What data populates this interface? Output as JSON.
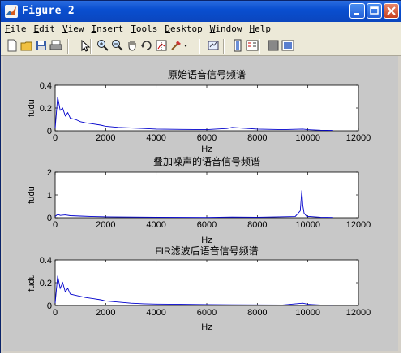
{
  "window": {
    "title": "Figure 2"
  },
  "menu": [
    {
      "label": "File",
      "u": "F",
      "rest": "ile"
    },
    {
      "label": "Edit",
      "u": "E",
      "rest": "dit"
    },
    {
      "label": "View",
      "u": "V",
      "rest": "iew"
    },
    {
      "label": "Insert",
      "u": "I",
      "rest": "nsert"
    },
    {
      "label": "Tools",
      "u": "T",
      "rest": "ools"
    },
    {
      "label": "Desktop",
      "u": "D",
      "rest": "esktop"
    },
    {
      "label": "Window",
      "u": "W",
      "rest": "indow"
    },
    {
      "label": "Help",
      "u": "H",
      "rest": "elp"
    }
  ],
  "toolbar": [
    {
      "icon": "new-figure-icon"
    },
    {
      "icon": "open-file-icon"
    },
    {
      "icon": "save-icon"
    },
    {
      "icon": "print-icon"
    },
    {
      "icon": "edit-plot-arrow-icon"
    },
    {
      "icon": "zoom-in-icon"
    },
    {
      "icon": "zoom-out-icon"
    },
    {
      "icon": "pan-hand-icon"
    },
    {
      "icon": "rotate-3d-icon"
    },
    {
      "icon": "data-cursor-icon"
    },
    {
      "icon": "brush-icon"
    },
    {
      "icon": "brush-dropdown-icon"
    },
    {
      "icon": "link-plot-icon"
    },
    {
      "icon": "insert-colorbar-icon"
    },
    {
      "icon": "insert-legend-icon"
    },
    {
      "icon": "hide-plot-tools-icon"
    },
    {
      "icon": "show-plot-tools-icon"
    }
  ],
  "chart_data": [
    {
      "type": "line",
      "title": "原始语音信号频谱",
      "xlabel": "Hz",
      "ylabel": "fudu",
      "xlim": [
        0,
        12000
      ],
      "ylim": [
        0,
        0.4
      ],
      "xticks": [
        "0",
        "2000",
        "4000",
        "6000",
        "8000",
        "10000",
        "12000"
      ],
      "yticks": [
        "0",
        "0.2",
        "0.4"
      ],
      "series": [
        {
          "color": "#0000cc",
          "x": [
            0,
            100,
            200,
            300,
            400,
            500,
            600,
            800,
            1000,
            1200,
            1500,
            1800,
            2000,
            2500,
            3000,
            3500,
            4000,
            5000,
            6000,
            6800,
            7000,
            7300,
            8000,
            9000,
            9800,
            10000,
            10500,
            11000
          ],
          "y": [
            0.02,
            0.3,
            0.18,
            0.2,
            0.13,
            0.16,
            0.11,
            0.1,
            0.08,
            0.07,
            0.06,
            0.05,
            0.04,
            0.03,
            0.025,
            0.02,
            0.015,
            0.012,
            0.01,
            0.02,
            0.03,
            0.025,
            0.015,
            0.01,
            0.015,
            0.01,
            0.005,
            0.003
          ]
        }
      ]
    },
    {
      "type": "line",
      "title": "叠加噪声的语音信号频谱",
      "xlabel": "Hz",
      "ylabel": "fudu",
      "xlim": [
        0,
        12000
      ],
      "ylim": [
        0,
        2
      ],
      "xticks": [
        "0",
        "2000",
        "4000",
        "6000",
        "8000",
        "10000",
        "12000"
      ],
      "yticks": [
        "0",
        "1",
        "2"
      ],
      "series": [
        {
          "color": "#0000cc",
          "x": [
            0,
            100,
            200,
            400,
            600,
            1000,
            1500,
            2000,
            3000,
            4000,
            6000,
            7000,
            8000,
            9500,
            9700,
            9760,
            9800,
            9850,
            9950,
            10500,
            11000
          ],
          "y": [
            0.05,
            0.15,
            0.1,
            0.12,
            0.09,
            0.07,
            0.05,
            0.04,
            0.03,
            0.02,
            0.01,
            0.03,
            0.02,
            0.05,
            0.3,
            1.2,
            0.55,
            0.2,
            0.06,
            0.02,
            0.01
          ]
        }
      ]
    },
    {
      "type": "line",
      "title": "FIR滤波后语音信号频谱",
      "xlabel": "Hz",
      "ylabel": "fudu",
      "xlim": [
        0,
        12000
      ],
      "ylim": [
        0,
        0.4
      ],
      "xticks": [
        "0",
        "2000",
        "4000",
        "6000",
        "8000",
        "10000",
        "12000"
      ],
      "yticks": [
        "0",
        "0.2",
        "0.4"
      ],
      "series": [
        {
          "color": "#0000cc",
          "x": [
            0,
            100,
            200,
            300,
            400,
            500,
            600,
            800,
            1000,
            1200,
            1500,
            1800,
            2000,
            2500,
            3000,
            3500,
            4000,
            5000,
            6000,
            7000,
            8000,
            9000,
            9800,
            10000,
            10500,
            11000
          ],
          "y": [
            0.02,
            0.26,
            0.15,
            0.2,
            0.12,
            0.15,
            0.1,
            0.09,
            0.08,
            0.07,
            0.06,
            0.05,
            0.04,
            0.03,
            0.02,
            0.015,
            0.012,
            0.01,
            0.008,
            0.006,
            0.005,
            0.004,
            0.02,
            0.01,
            0.004,
            0.002
          ]
        }
      ]
    }
  ]
}
